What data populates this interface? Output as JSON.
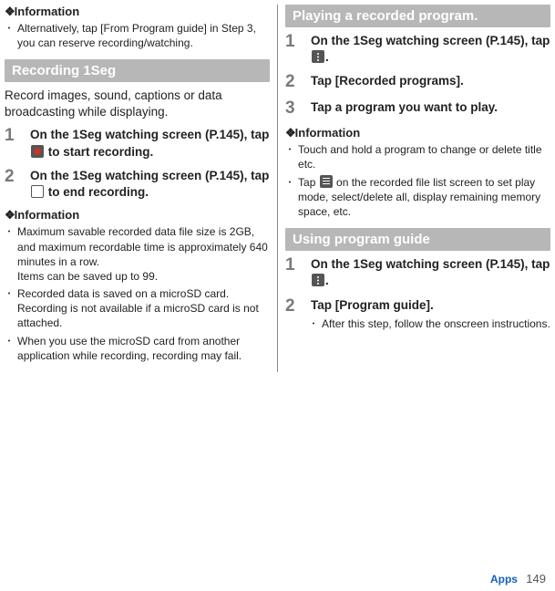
{
  "left": {
    "info1": {
      "heading_prefix": "❖",
      "heading": "Information",
      "items": [
        "Alternatively, tap [From Program guide] in Step 3, you can reserve recording/watching."
      ]
    },
    "section": {
      "title": "Recording 1Seg",
      "intro": "Record images, sound, captions or data broadcasting while displaying.",
      "steps": [
        {
          "num": "1",
          "pre": "On the 1Seg watching screen (P.145), tap ",
          "icon": "rec",
          "post": " to start recording."
        },
        {
          "num": "2",
          "pre": "On the 1Seg watching screen (P.145), tap ",
          "icon": "stop",
          "post": " to end recording."
        }
      ]
    },
    "info2": {
      "heading_prefix": "❖",
      "heading": "Information",
      "items": [
        "Maximum savable recorded data file size is 2GB, and maximum recordable time is approximately 640 minutes in a row.\nItems can be saved up to 99.",
        "Recorded data is saved on a microSD card. Recording is not available if a microSD card is not attached.",
        "When you use the microSD card from another application while recording, recording may fail."
      ]
    }
  },
  "right": {
    "section1": {
      "title": "Playing a recorded program.",
      "steps": [
        {
          "num": "1",
          "pre": "On the 1Seg watching screen (P.145), tap ",
          "icon": "more",
          "post": "."
        },
        {
          "num": "2",
          "text": "Tap [Recorded programs]."
        },
        {
          "num": "3",
          "text": "Tap a program you want to play."
        }
      ]
    },
    "info1": {
      "heading_prefix": "❖",
      "heading": "Information",
      "items_icon": [
        {
          "text": "Touch and hold a program to change or delete title etc."
        },
        {
          "pre": "Tap ",
          "icon": "list",
          "post": " on the recorded file list screen to set play mode, select/delete all, display remaining memory space, etc."
        }
      ]
    },
    "section2": {
      "title": "Using program guide",
      "steps": [
        {
          "num": "1",
          "pre": "On the 1Seg watching screen (P.145), tap ",
          "icon": "more",
          "post": "."
        },
        {
          "num": "2",
          "text": "Tap [Program guide].",
          "sub": "After this step, follow the onscreen instructions."
        }
      ]
    }
  },
  "footer": {
    "label": "Apps",
    "page": "149"
  }
}
